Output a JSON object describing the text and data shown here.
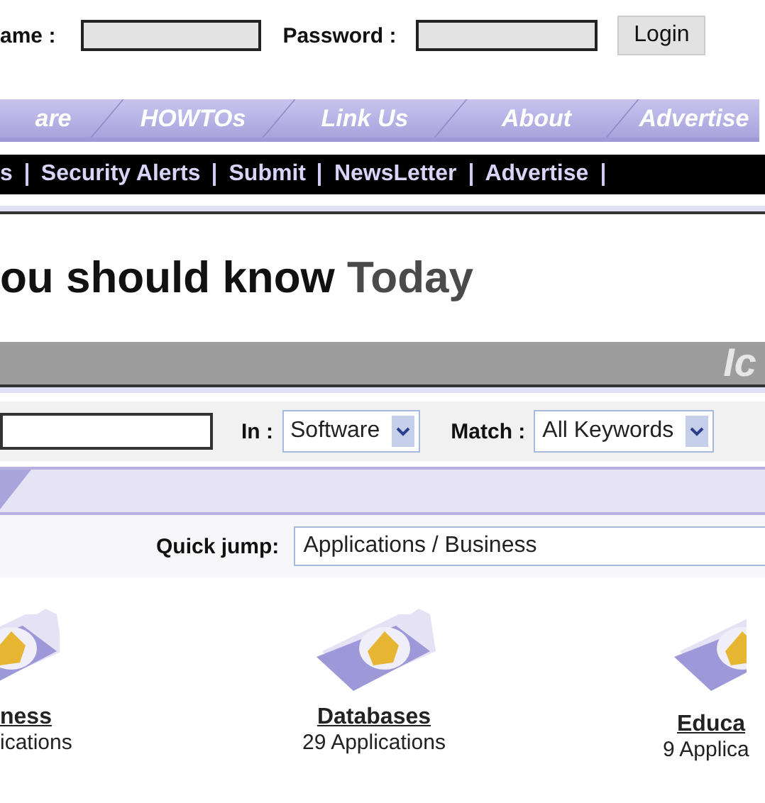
{
  "login": {
    "name_label": "ame :",
    "password_label": "Password :",
    "button": "Login"
  },
  "tabs": [
    {
      "label": "are"
    },
    {
      "label": "HOWTOs"
    },
    {
      "label": "Link Us"
    },
    {
      "label": "About"
    },
    {
      "label": "Advertise"
    }
  ],
  "links": [
    "s",
    "Security Alerts",
    "Submit",
    "NewsLetter",
    "Advertise"
  ],
  "heading": {
    "text": "ou should know",
    "highlight": "Today"
  },
  "banner": {
    "logo_text": "Ic"
  },
  "search": {
    "in_label": "In :",
    "in_value": "Software",
    "match_label": "Match :",
    "match_value": "All Keywords"
  },
  "quick_jump": {
    "label": "Quick jump:",
    "value": "Applications / Business"
  },
  "categories": [
    {
      "name": "ness",
      "count": "ications"
    },
    {
      "name": "Databases",
      "count": "29 Applications"
    },
    {
      "name": "Educa",
      "count": "9 Applica"
    }
  ]
}
